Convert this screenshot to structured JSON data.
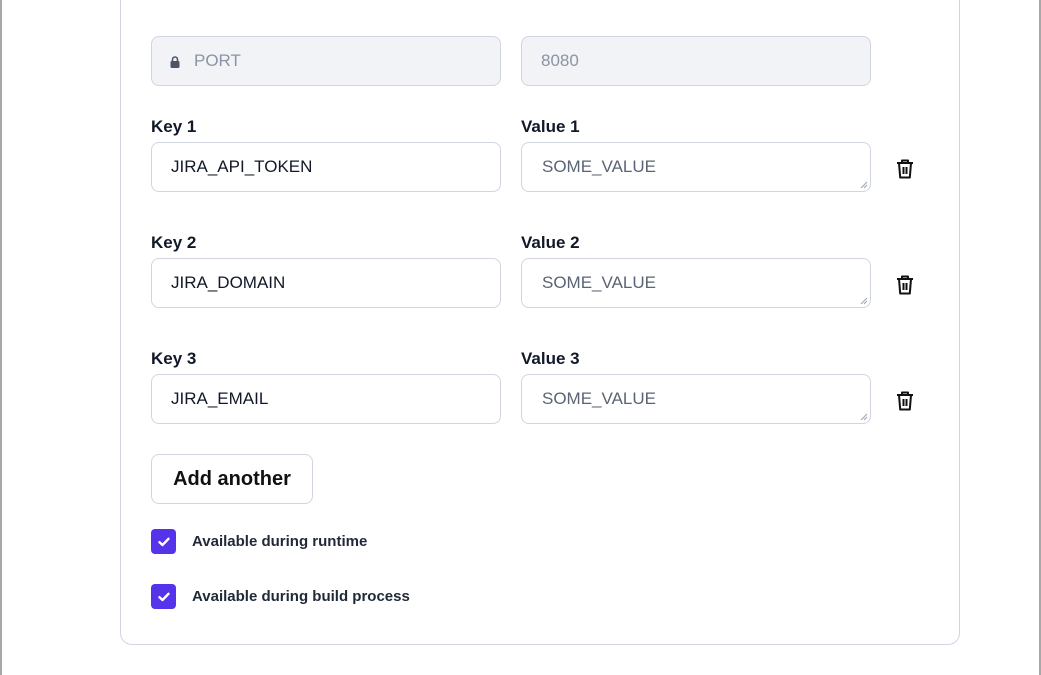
{
  "locked_row": {
    "key": "PORT",
    "value": "8080",
    "key_icon": "lock-icon"
  },
  "rows": [
    {
      "key_label": "Key 1",
      "value_label": "Value 1",
      "key": "JIRA_API_TOKEN",
      "value": "SOME_VALUE",
      "delete_icon": "trash-icon"
    },
    {
      "key_label": "Key 2",
      "value_label": "Value 2",
      "key": "JIRA_DOMAIN",
      "value": "SOME_VALUE",
      "delete_icon": "trash-icon"
    },
    {
      "key_label": "Key 3",
      "value_label": "Value 3",
      "key": "JIRA_EMAIL",
      "value": "SOME_VALUE",
      "delete_icon": "trash-icon"
    }
  ],
  "add_button_label": "Add another",
  "options": [
    {
      "label": "Available during runtime",
      "checked": true
    },
    {
      "label": "Available during build process",
      "checked": true
    }
  ],
  "colors": {
    "accent": "#5433eb",
    "border": "#d1d5e0",
    "disabled_bg": "#f1f3f7"
  }
}
